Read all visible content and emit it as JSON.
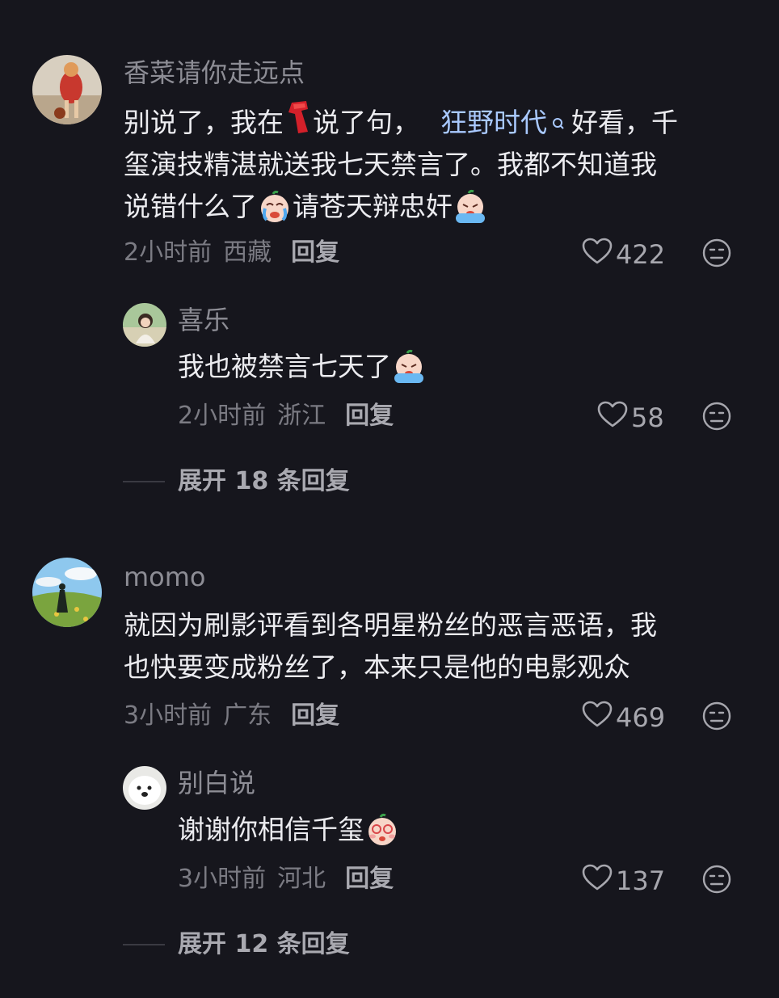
{
  "comments": [
    {
      "username": "香菜请你走远点",
      "lines": [
        {
          "a": "别说了，我在",
          "b": "说了句，",
          "link": "狂野时代",
          "c": "好看，千"
        },
        {
          "text": "玺演技精湛就送我七天禁言了。我都不知道我"
        },
        {
          "a": "说错什么了",
          "b": "请苍天辩忠奸"
        }
      ],
      "time": "2小时前",
      "location": "西藏",
      "reply_label": "回复",
      "likes": "422",
      "replies": [
        {
          "username": "喜乐",
          "text": "我也被禁言七天了",
          "time": "2小时前",
          "location": "浙江",
          "reply_label": "回复",
          "likes": "58"
        }
      ],
      "expand_label": "展开 18 条回复"
    },
    {
      "username": "momo",
      "lines": [
        {
          "text": "就因为刷影评看到各明星粉丝的恶言恶语，我"
        },
        {
          "text": "也快要变成粉丝了，本来只是他的电影观众"
        }
      ],
      "time": "3小时前",
      "location": "广东",
      "reply_label": "回复",
      "likes": "469",
      "replies": [
        {
          "username": "别白说",
          "text": "谢谢你相信千玺",
          "time": "3小时前",
          "location": "河北",
          "reply_label": "回复",
          "likes": "137"
        }
      ],
      "expand_label": "展开 12 条回复"
    }
  ],
  "icons": {
    "like": "heart-outline-icon",
    "dislike": "meh-face-icon",
    "search": "search-icon"
  },
  "colors": {
    "background": "#16161d",
    "link": "#a9c9ff"
  }
}
